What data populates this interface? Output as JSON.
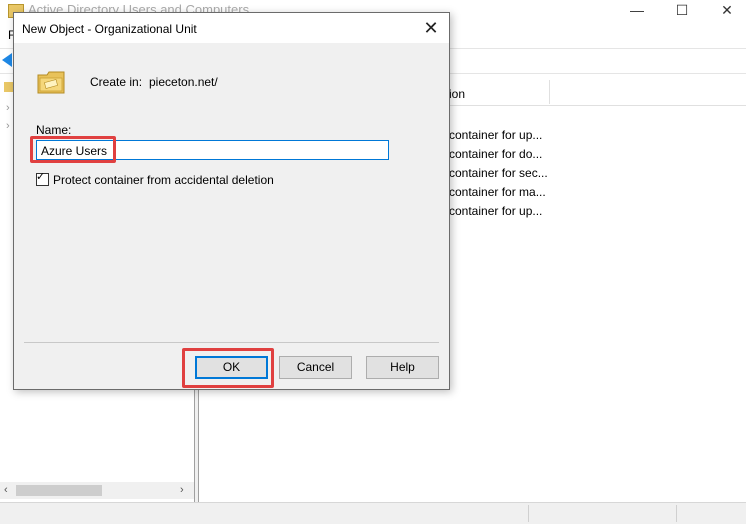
{
  "background_window": {
    "title": "Active Directory Users and Computers",
    "menu_first_letter": "F",
    "column_header": "ion",
    "rows": [
      "container for up...",
      "container for do...",
      "container for sec...",
      "container for ma...",
      "container for up..."
    ],
    "controls": {
      "minimize": "—",
      "maximize": "☐",
      "close": "✕"
    }
  },
  "dialog": {
    "title": "New Object - Organizational Unit",
    "close_glyph": "✕",
    "create_in_label": "Create in:",
    "create_in_value": "pieceton.net/",
    "name_label": "Name:",
    "name_value": "Azure Users",
    "protect_label": "Protect container from accidental deletion",
    "protect_checked": true,
    "buttons": {
      "ok": "OK",
      "cancel": "Cancel",
      "help": "Help"
    }
  },
  "colors": {
    "highlight": "#e04040",
    "focus": "#0078d7"
  },
  "icons": [
    "folder-ou-icon",
    "app-icon",
    "back-arrow-icon"
  ]
}
